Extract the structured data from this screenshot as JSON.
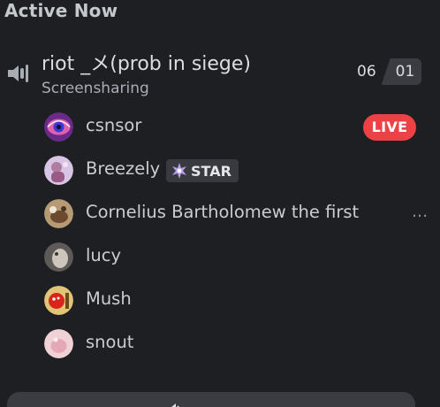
{
  "header": {
    "title": "Active Now"
  },
  "channel": {
    "name": "riot _メ(prob in siege)",
    "status": "Screensharing",
    "count_a": "06",
    "count_b": "01",
    "icon": "voice-channel-icon"
  },
  "members": [
    {
      "name": "csnsor",
      "avatar_color": "#c43a8f",
      "badge": "LIVE"
    },
    {
      "name": "Breezely",
      "avatar_color": "#c8a8d8",
      "badge": "STAR"
    },
    {
      "name": "Cornelius Bartholomew the first",
      "avatar_color": "#8a6a48",
      "overflow": "..."
    },
    {
      "name": "lucy",
      "avatar_color": "#6f6a66"
    },
    {
      "name": "Mush",
      "avatar_color": "#d8b25a"
    },
    {
      "name": "snout",
      "avatar_color": "#e8c2c8"
    }
  ],
  "colors": {
    "live": "#ec4245",
    "background": "#1e1f22"
  },
  "bottom_button": {
    "label": "",
    "icon": "speaker-icon"
  }
}
